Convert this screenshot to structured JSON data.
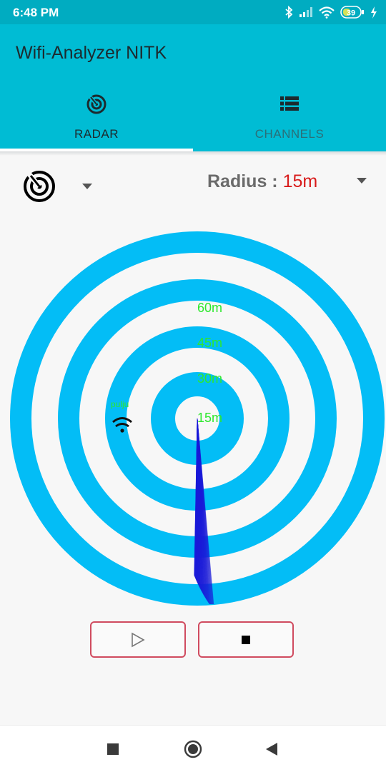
{
  "status_bar": {
    "time": "6:48 PM",
    "battery": "39",
    "icons": [
      "bluetooth-icon",
      "signal-icon",
      "wifi-icon",
      "battery-icon",
      "charging-icon"
    ]
  },
  "app": {
    "title": "Wifi-Analyzer NITK",
    "tabs": [
      {
        "label": "RADAR",
        "icon": "radar-icon",
        "selected": true
      },
      {
        "label": "CHANNELS",
        "icon": "list-icon",
        "selected": false
      }
    ]
  },
  "controls": {
    "mode_icon": "radar-icon",
    "radius_label": "Radius :",
    "radius_value": "15m"
  },
  "radar": {
    "ring_labels": [
      "15m",
      "30m",
      "45m",
      "60m"
    ],
    "network": {
      "name": "pulju",
      "icon": "wifi-icon"
    },
    "colors": {
      "ring": "#03bdf6",
      "label": "#2ee82e",
      "sweep": "#1a1ad8"
    }
  },
  "buttons": {
    "play_icon": "play-icon",
    "stop_icon": "stop-icon"
  },
  "nav_bar": {
    "icons": [
      "recents-icon",
      "home-icon",
      "back-icon"
    ]
  }
}
